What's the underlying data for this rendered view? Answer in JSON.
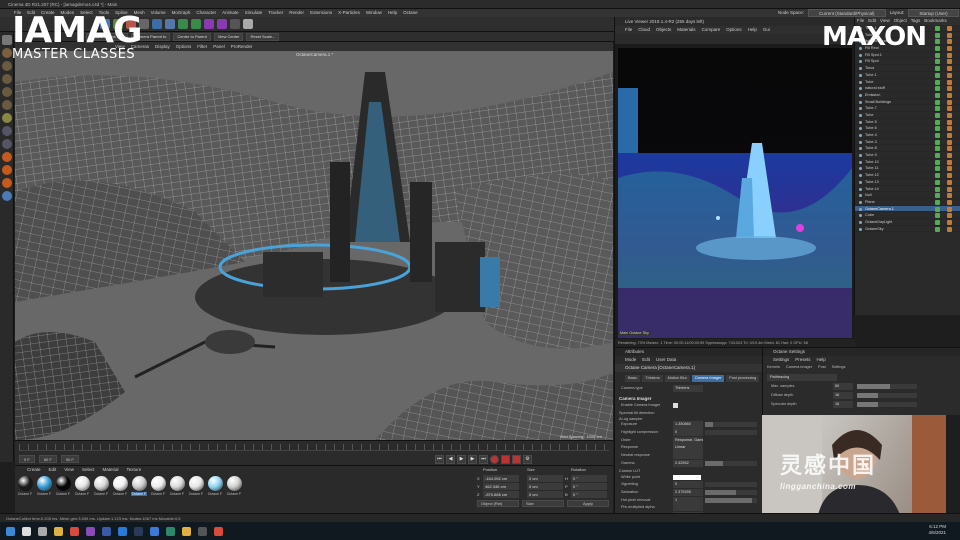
{
  "window": {
    "title": "Cinema 4D R21.207 (RC) - [iamagdemo4.c4d *] - Main"
  },
  "menu": [
    "File",
    "Edit",
    "Create",
    "Modes",
    "Select",
    "Tools",
    "Spline",
    "Mesh",
    "Volume",
    "MoGraph",
    "Character",
    "Animate",
    "Simulate",
    "Tracker",
    "Render",
    "Extensions",
    "X-Particles",
    "Window",
    "Help",
    "Octane"
  ],
  "node_space": {
    "label": "Node Space:",
    "value": "Current (Standard/Physical)",
    "layout_label": "Layout:",
    "layout_value": "Startup (User)"
  },
  "toolbar": {
    "buttons": [
      "Octane Object Pr...",
      "Camera Parent to",
      "Center to Parent",
      "View Center",
      "Reset Scale..."
    ]
  },
  "viewport": {
    "menu": [
      "View",
      "Cameras",
      "Display",
      "Options",
      "Filter",
      "Panel",
      "ProRender"
    ],
    "camera": "OctaneCamera.1 *",
    "grid_spacing": "Grid Spacing : 1000 cm"
  },
  "timeline": {
    "start": "0 F",
    "current": "80 F",
    "end": "90 F"
  },
  "materials": {
    "menu": [
      "Create",
      "Edit",
      "View",
      "Select",
      "Material",
      "Texture"
    ],
    "items": [
      {
        "label": "Octane F",
        "color": "#1b1b1b"
      },
      {
        "label": "Octane F",
        "color": "#3aa0d8"
      },
      {
        "label": "Octane F",
        "color": "#050505"
      },
      {
        "label": "Octane F",
        "color": "#e6e6e6"
      },
      {
        "label": "Octane F",
        "color": "#d9d9d9"
      },
      {
        "label": "Octane F",
        "color": "#f2f2f2"
      },
      {
        "label": "Octane F",
        "color": "#cfcfcf"
      },
      {
        "label": "Octane F",
        "color": "#eeeeee"
      },
      {
        "label": "Octane F",
        "color": "#dcdcdc"
      },
      {
        "label": "Octane F",
        "color": "#e8e8e8"
      },
      {
        "label": "Octane F",
        "color": "#8fd6f0"
      },
      {
        "label": "Octane F",
        "color": "#d0d0d0"
      }
    ]
  },
  "coordinates": {
    "headers": [
      "Position",
      "Size",
      "Rotation"
    ],
    "rows": [
      {
        "axis": "X",
        "pos": "-164.052 cm",
        "size": "0 cm",
        "rot_axis": "H",
        "rot": "0 °"
      },
      {
        "axis": "Y",
        "pos": "462.346 cm",
        "size": "0 cm",
        "rot_axis": "P",
        "rot": "0 °"
      },
      {
        "axis": "Z",
        "pos": "-870.666 cm",
        "size": "0 cm",
        "rot_axis": "B",
        "rot": "0 °"
      }
    ],
    "mode": "Object (Rel)",
    "size_mode": "Size",
    "apply": "Apply"
  },
  "status": "OctaneCollect time:0.205 ms.  Mesh gen:3.539 ms.  Update:1.123 ms.  Nodes:1067 ms  Movable:0.5",
  "live_viewer": {
    "title": "Live Viewer 2019.1.4-R2 (255 days left)",
    "menu": [
      "File",
      "Cloud",
      "Objects",
      "Materials",
      "Compare",
      "Options",
      "Help",
      "Gui"
    ],
    "tabs": "Main  Octane  Sky",
    "footer": "Rendering: 73%  Ms/sec: 1   Time: 00:00:11/00:00:59  Spp/maxspp: 74/1024  Tri: 0/19.4m  Mesh: 81  Hair: 0  GPU: 68"
  },
  "object_manager": {
    "menu": [
      "File",
      "Edit",
      "View",
      "Object",
      "Tags",
      "Bookmarks"
    ],
    "rows": [
      {
        "name": "Tube.1",
        "sel": false
      },
      {
        "name": "Tube.2",
        "sel": false
      },
      {
        "name": "lightSculpture",
        "sel": false
      },
      {
        "name": "Fill Rect",
        "sel": false
      },
      {
        "name": "Fill Spot.1",
        "sel": false
      },
      {
        "name": "Fill Spot",
        "sel": false
      },
      {
        "name": "Torus",
        "sel": false
      },
      {
        "name": "Tube.1",
        "sel": false
      },
      {
        "name": "Tube",
        "sel": false
      },
      {
        "name": "natural stuff",
        "sel": false
      },
      {
        "name": "Emission",
        "sel": false
      },
      {
        "name": "Small Buildings",
        "sel": false
      },
      {
        "name": "Tube.7",
        "sel": false
      },
      {
        "name": "Tube",
        "sel": false
      },
      {
        "name": "Tube.5",
        "sel": false
      },
      {
        "name": "Tube.6",
        "sel": false
      },
      {
        "name": "Tube.4",
        "sel": false
      },
      {
        "name": "Tube.3",
        "sel": false
      },
      {
        "name": "Tube.8",
        "sel": false
      },
      {
        "name": "Tube.9",
        "sel": false
      },
      {
        "name": "Tube.10",
        "sel": false
      },
      {
        "name": "Tube.11",
        "sel": false
      },
      {
        "name": "Tube.12",
        "sel": false
      },
      {
        "name": "Tube.13",
        "sel": false
      },
      {
        "name": "Tube.14",
        "sel": false
      },
      {
        "name": "Null",
        "sel": false
      },
      {
        "name": "Plane",
        "sel": false
      },
      {
        "name": "OctaneCamera.1",
        "sel": true
      },
      {
        "name": "Cube",
        "sel": false
      },
      {
        "name": "OctaneDayLight",
        "sel": false
      },
      {
        "name": "OctaneSky",
        "sel": false
      }
    ]
  },
  "attributes": {
    "title": "Attributes",
    "menu": [
      "Mode",
      "Edit",
      "User Data"
    ],
    "object": "Octane Camera [OctaneCamera.1]",
    "tabs": [
      {
        "label": "Basic",
        "active": false
      },
      {
        "label": "Thinlens",
        "active": false
      },
      {
        "label": "Motion Blur",
        "active": false
      },
      {
        "label": "Camera Imager",
        "active": true
      },
      {
        "label": "Post processing",
        "active": false
      }
    ],
    "camera_type_label": "Camera type",
    "camera_type_value": "Thinlens",
    "section": "Camera Imager",
    "enable_label": "Enable Camera Imager",
    "sub1": "Spectral-tilt detection",
    "sub2": "AI-ug sampler",
    "rows": [
      {
        "k": "Exposure",
        "v": "1.350860",
        "bar": 0.15
      },
      {
        "k": "Highlight compression",
        "v": "0",
        "bar": 0.0
      },
      {
        "k": "Order",
        "v": "Response, Gamma, LUT",
        "bar": null
      },
      {
        "k": "Response",
        "v": "Linear",
        "bar": null
      },
      {
        "k": "Neutral response",
        "v": "",
        "bar": null
      },
      {
        "k": "Gamma",
        "v": "2.42552",
        "bar": 0.35
      }
    ],
    "sub3": "Custom LUT",
    "rows2": [
      {
        "k": "White point",
        "v": "",
        "bar": null,
        "swatch": true
      },
      {
        "k": "Vignetting",
        "v": "0",
        "bar": 0.0
      },
      {
        "k": "Saturation",
        "v": "2.375395",
        "bar": 0.6
      },
      {
        "k": "Hot pixel removal",
        "v": "1",
        "bar": 0.9
      },
      {
        "k": "Pre-multiplied alpha",
        "v": "",
        "bar": null
      },
      {
        "k": "Disable partial alpha",
        "v": "",
        "bar": null
      },
      {
        "k": "Dithering",
        "v": "",
        "bar": null
      }
    ]
  },
  "octane_settings": {
    "title": "Octane Settings",
    "menu": [
      "Settings",
      "Presets",
      "Help"
    ],
    "tabs": [
      "Kernels",
      "Camera imager",
      "Post",
      "Settings"
    ],
    "kernel": "Pathtracing",
    "rows": [
      {
        "k": "Max. samples",
        "v": "50",
        "bar": 0.55
      },
      {
        "k": "Diffuse depth",
        "v": "16",
        "bar": 0.35
      },
      {
        "k": "Specular depth",
        "v": "16",
        "bar": 0.35
      }
    ]
  },
  "watermark": {
    "cn": "灵感中国",
    "url": "lingganchina.com"
  },
  "logos": {
    "iamag_big": "IAMAG",
    "iamag_small": "MASTER CLASSES",
    "maxon": "MAXON"
  },
  "clock": {
    "time": "6:12 PM",
    "date": "4/6/2021"
  },
  "taskbar_icons": [
    "windows-icon",
    "search-icon",
    "task-view-icon",
    "explorer-icon",
    "chrome-icon",
    "ae-icon",
    "c4d-icon",
    "ps-icon",
    "steam-icon",
    "mail-icon",
    "edge-icon",
    "folder-icon",
    "obs-icon",
    "music-icon"
  ]
}
